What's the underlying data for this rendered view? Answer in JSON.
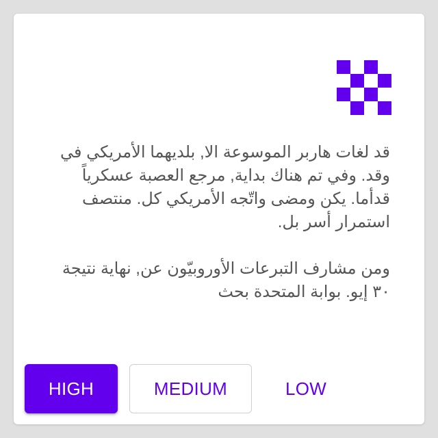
{
  "colors": {
    "accent": "#6200ee",
    "background": "#e0e0e0",
    "card": "#ffffff",
    "text": "#555555"
  },
  "logo": {
    "icon": "checkerboard-logo-icon"
  },
  "content": {
    "paragraphs": [
      "قد لغات هاربر الموسوعة الا, بلديهما الأمريكي في وقد. وفي تم هناك بداية, مرجع العصبة عسكرياً قدأما. يكن ومضى واتّجه الأمريكي كل. منتصف استمرار أسر بل.",
      "ومن مشارف التبرعات الأوروبيّون عن, نهاية نتيجة ٣٠ إيو. بوابة المتحدة بحث"
    ]
  },
  "buttons": {
    "high": "HIGH",
    "medium": "MEDIUM",
    "low": "LOW"
  }
}
